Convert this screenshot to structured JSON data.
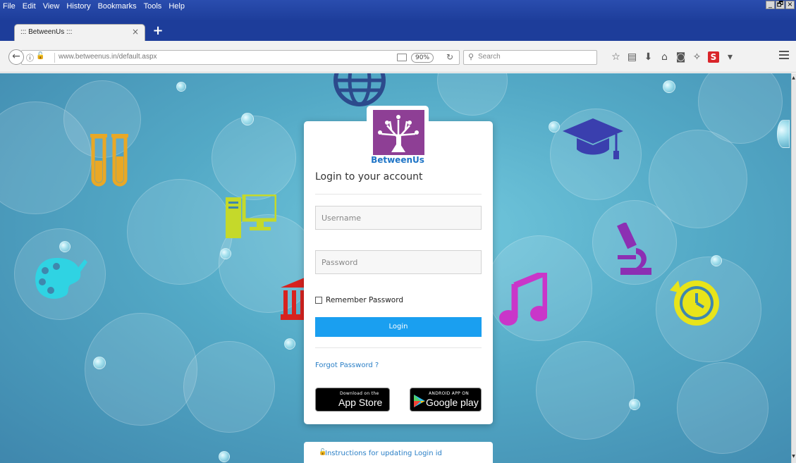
{
  "menubar": {
    "items": [
      "File",
      "Edit",
      "View",
      "History",
      "Bookmarks",
      "Tools",
      "Help"
    ]
  },
  "tab": {
    "title": "::: BetweenUs :::",
    "close": "×",
    "new_tab": "+"
  },
  "nav": {
    "url": "www.betweenus.in/default.aspx",
    "zoom": "90%",
    "search_placeholder": "Search",
    "reload": "C"
  },
  "toolbar": {
    "s_button": "S",
    "s_dropdown": "▾"
  },
  "window_controls": [
    "_",
    "🗗",
    "×"
  ],
  "login": {
    "brand": "BetweenUs",
    "heading": "Login to your account",
    "username_placeholder": "Username",
    "password_placeholder": "Password",
    "remember_label": "Remember Password",
    "login_button": "Login",
    "forgot_password": "Forgot Password ?",
    "app_store_small": "Download on the",
    "app_store_big": "App Store",
    "google_small": "ANDROID APP ON",
    "google_big": "Google play",
    "instructions": "Instructions for updating Login id"
  },
  "colors": {
    "accent": "#1a9ff0",
    "brand_purple": "#8e3f95",
    "link": "#2a7fc6",
    "background": "#53a9c6"
  },
  "icons": [
    "test-tubes-icon",
    "computer-icon",
    "palette-icon",
    "bank-icon",
    "globe-icon",
    "graduation-cap-icon",
    "microscope-icon",
    "music-note-icon",
    "clock-icon"
  ]
}
